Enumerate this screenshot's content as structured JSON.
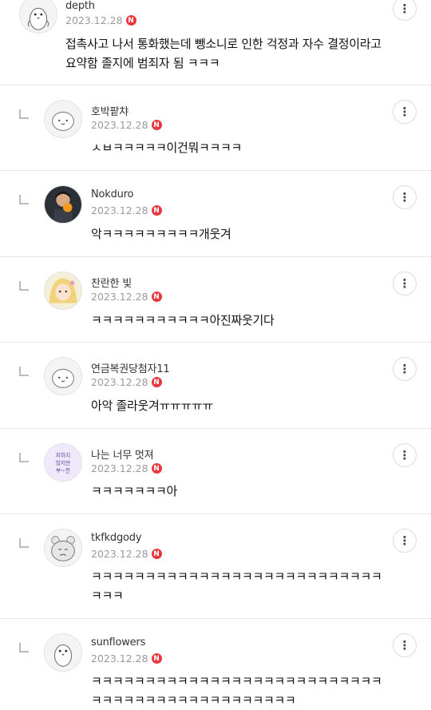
{
  "comments": [
    {
      "author": "depth",
      "date": "2023.12.28",
      "badge": "N",
      "text": "접촉사고 나서 통화했는데 뺑소니로 인한 걱정과 자수 결정이라고 요약함 졸지에 범죄자 됨 ㅋㅋㅋ",
      "avatar": "penguin",
      "more": "⋮"
    },
    {
      "author": "호박팥챠",
      "date": "2023.12.28",
      "badge": "N",
      "text": "ㅅㅂㅋㅋㅋㅋㅋ이건뭐ㅋㅋㅋㅋ",
      "avatar": "default-face",
      "more": "⋮"
    },
    {
      "author": "Nokduro",
      "date": "2023.12.28",
      "badge": "N",
      "text": "악ㅋㅋㅋㅋㅋㅋㅋㅋㅋ개웃겨",
      "avatar": "photo",
      "more": "⋮"
    },
    {
      "author": "찬란한 빛",
      "date": "2023.12.28",
      "badge": "N",
      "text": "ㅋㅋㅋㅋㅋㅋㅋㅋㅋㅋㅋ아진짜웃기다",
      "avatar": "anime",
      "more": "⋮"
    },
    {
      "author": "연금복권당첨자11",
      "date": "2023.12.28",
      "badge": "N",
      "text": "아악 졸라웃겨ㅠㅠㅠㅠㅠ",
      "avatar": "default-face",
      "more": "⋮"
    },
    {
      "author": "나는 너무 멋져",
      "date": "2023.12.28",
      "badge": "N",
      "text": "ㅋㅋㅋㅋㅋㅋㅋ아",
      "avatar": "text-badge",
      "more": "⋮",
      "avatar_text": [
        "피하지",
        "않지만",
        "부~전"
      ]
    },
    {
      "author": "tkfkdgody",
      "date": "2023.12.28",
      "badge": "N",
      "text": "ㅋㅋㅋㅋㅋㅋㅋㅋㅋㅋㅋㅋㅋㅋㅋㅋㅋㅋㅋㅋㅋㅋㅋㅋㅋㅋㅋㅋㅋㅋ",
      "avatar": "bear",
      "more": "⋮"
    },
    {
      "author": "sunflowers",
      "date": "2023.12.28",
      "badge": "N",
      "text": "ㅋㅋㅋㅋㅋㅋㅋㅋㅋㅋㅋㅋㅋㅋㅋㅋㅋㅋㅋㅋㅋㅋㅋㅋㅋㅋㅋㅋㅋㅋㅋㅋㅋㅋㅋㅋㅋㅋㅋㅋㅋㅋㅋㅋㅋㅋ",
      "avatar": "penguin",
      "more": "⋮"
    }
  ]
}
